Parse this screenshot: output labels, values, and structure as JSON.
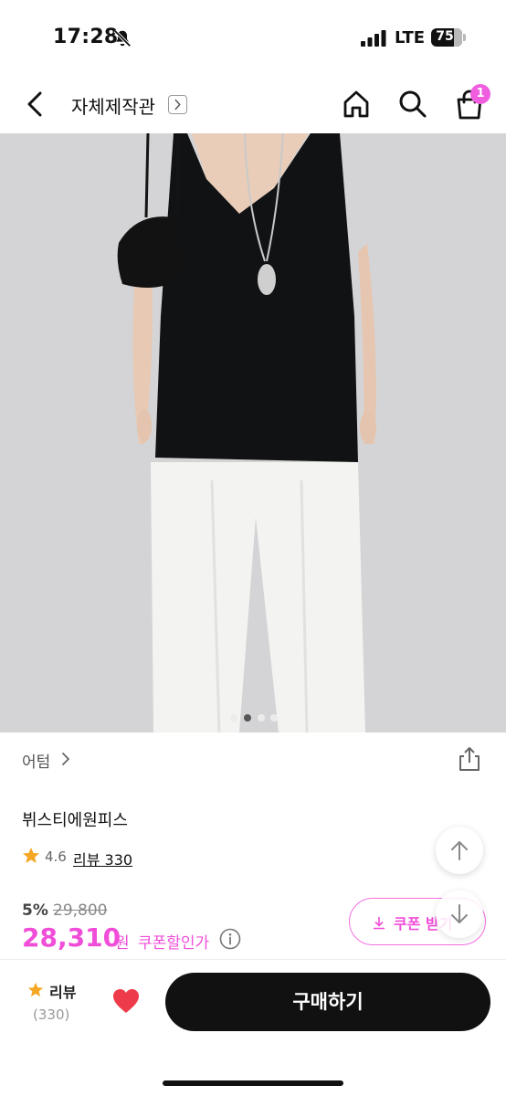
{
  "status_bar": {
    "time": "17:28",
    "network": "LTE",
    "battery": "75"
  },
  "header": {
    "shop_title": "자체제작관",
    "cart_count": "1"
  },
  "gallery": {
    "current_index": 2,
    "total": 4,
    "alt": "black sleeveless dress over white pants with black bag"
  },
  "product": {
    "brand": "어텀",
    "name": "뷔스티에원피스",
    "rating": "4.6",
    "review_link": "리뷰 330",
    "discount_rate": "5%",
    "original_price": "29,800",
    "sale_price": "28,310",
    "currency": "원",
    "coupon_price_label": "쿠폰할인가",
    "coupon_button_label": "쿠폰 받기"
  },
  "bottom_bar": {
    "review_label": "리뷰",
    "review_count": "(330)",
    "buy_label": "구매하기"
  },
  "colors": {
    "accent": "#f04ed8",
    "badge": "#f05ee0",
    "star": "#f5a623",
    "heart": "#ee3b4a",
    "buy_button": "#111111"
  }
}
